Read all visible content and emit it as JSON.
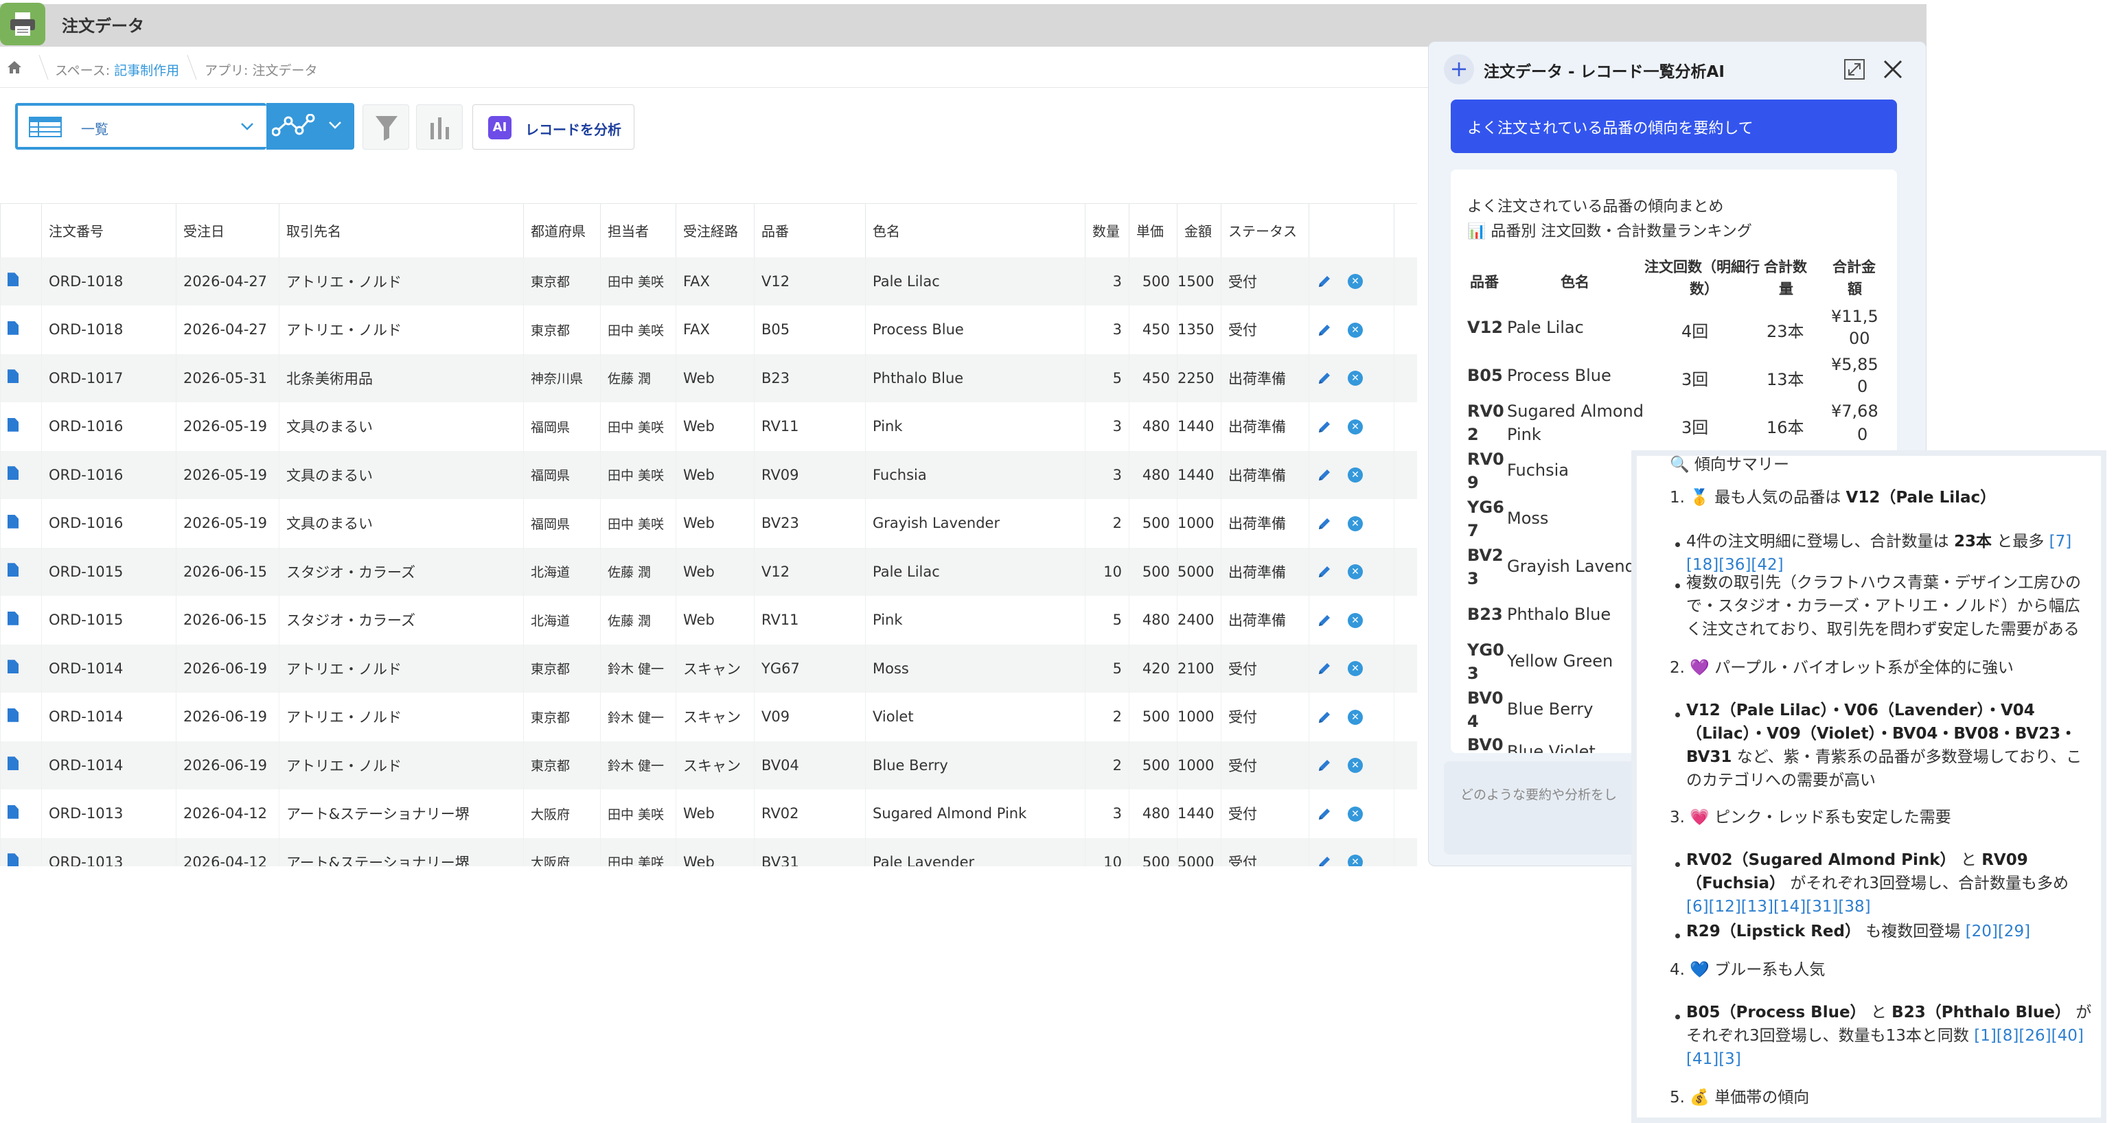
{
  "app": {
    "title": "注文データ"
  },
  "breadcrumb": {
    "space_prefix": "スペース:",
    "space_link": "記事制作用",
    "app_crumb": "アプリ: 注文データ"
  },
  "toolbar": {
    "view_label": "一覧",
    "analyze_label": "レコードを分析",
    "ai_badge": "AI"
  },
  "table": {
    "headers": [
      "注文番号",
      "受注日",
      "取引先名",
      "都道府県",
      "担当者",
      "受注経路",
      "品番",
      "色名",
      "数量",
      "単価",
      "金額",
      "ステータス"
    ],
    "rows": [
      [
        "ORD-1018",
        "2026-04-27",
        "アトリエ・ノルド",
        "東京都",
        "田中 美咲",
        "FAX",
        "V12",
        "Pale Lilac",
        "3",
        "500",
        "1500",
        "受付"
      ],
      [
        "ORD-1018",
        "2026-04-27",
        "アトリエ・ノルド",
        "東京都",
        "田中 美咲",
        "FAX",
        "B05",
        "Process Blue",
        "3",
        "450",
        "1350",
        "受付"
      ],
      [
        "ORD-1017",
        "2026-05-31",
        "北条美術用品",
        "神奈川県",
        "佐藤 潤",
        "Web",
        "B23",
        "Phthalo Blue",
        "5",
        "450",
        "2250",
        "出荷準備"
      ],
      [
        "ORD-1016",
        "2026-05-19",
        "文具のまるい",
        "福岡県",
        "田中 美咲",
        "Web",
        "RV11",
        "Pink",
        "3",
        "480",
        "1440",
        "出荷準備"
      ],
      [
        "ORD-1016",
        "2026-05-19",
        "文具のまるい",
        "福岡県",
        "田中 美咲",
        "Web",
        "RV09",
        "Fuchsia",
        "3",
        "480",
        "1440",
        "出荷準備"
      ],
      [
        "ORD-1016",
        "2026-05-19",
        "文具のまるい",
        "福岡県",
        "田中 美咲",
        "Web",
        "BV23",
        "Grayish Lavender",
        "2",
        "500",
        "1000",
        "出荷準備"
      ],
      [
        "ORD-1015",
        "2026-06-15",
        "スタジオ・カラーズ",
        "北海道",
        "佐藤 潤",
        "Web",
        "V12",
        "Pale Lilac",
        "10",
        "500",
        "5000",
        "出荷準備"
      ],
      [
        "ORD-1015",
        "2026-06-15",
        "スタジオ・カラーズ",
        "北海道",
        "佐藤 潤",
        "Web",
        "RV11",
        "Pink",
        "5",
        "480",
        "2400",
        "出荷準備"
      ],
      [
        "ORD-1014",
        "2026-06-19",
        "アトリエ・ノルド",
        "東京都",
        "鈴木 健一",
        "スキャン",
        "YG67",
        "Moss",
        "5",
        "420",
        "2100",
        "受付"
      ],
      [
        "ORD-1014",
        "2026-06-19",
        "アトリエ・ノルド",
        "東京都",
        "鈴木 健一",
        "スキャン",
        "V09",
        "Violet",
        "2",
        "500",
        "1000",
        "受付"
      ],
      [
        "ORD-1014",
        "2026-06-19",
        "アトリエ・ノルド",
        "東京都",
        "鈴木 健一",
        "スキャン",
        "BV04",
        "Blue Berry",
        "2",
        "500",
        "1000",
        "受付"
      ],
      [
        "ORD-1013",
        "2026-04-12",
        "アート&ステーショナリー堺",
        "大阪府",
        "田中 美咲",
        "Web",
        "RV02",
        "Sugared Almond Pink",
        "3",
        "480",
        "1440",
        "受付"
      ],
      [
        "ORD-1013",
        "2026-04-12",
        "アート&ステーショナリー堺",
        "大阪府",
        "田中 美咲",
        "Web",
        "BV31",
        "Pale Lavender",
        "10",
        "500",
        "5000",
        "受付"
      ]
    ]
  },
  "ai_panel": {
    "title": "注文データ - レコード一覧分析AI",
    "prompt": "よく注文されている品番の傾向を要約して",
    "result_title": "よく注文されている品番の傾向まとめ",
    "result_subtitle": "📊 品番別 注文回数・合計数量ランキング",
    "table_headers": {
      "code": "品番",
      "color": "色名",
      "count_1": "注文回数（明細行",
      "count_2": "数）",
      "qty_1": "合計数",
      "qty_2": "量",
      "amt_1": "合計金",
      "amt_2": "額"
    },
    "table_rows": [
      {
        "code": [
          "V12"
        ],
        "color": [
          "Pale Lilac"
        ],
        "count": "4回",
        "qty": "23本",
        "amount": [
          "¥11,5",
          "00"
        ]
      },
      {
        "code": [
          "B05"
        ],
        "color": [
          "Process Blue"
        ],
        "count": "3回",
        "qty": "13本",
        "amount": [
          "¥5,85",
          "0"
        ]
      },
      {
        "code": [
          "RV0",
          "2"
        ],
        "color": [
          "Sugared Almond",
          "Pink"
        ],
        "count": "3回",
        "qty": "16本",
        "amount": [
          "¥7,68",
          "0"
        ]
      },
      {
        "code": [
          "RV0",
          "9"
        ],
        "color": [
          "Fuchsia"
        ]
      },
      {
        "code": [
          "YG6",
          "7"
        ],
        "color": [
          "Moss"
        ]
      },
      {
        "code": [
          "BV2",
          "3"
        ],
        "color": [
          "Grayish Lavende"
        ]
      },
      {
        "code": [
          "B23"
        ],
        "color": [
          "Phthalo Blue"
        ]
      },
      {
        "code": [
          "YG0",
          "3"
        ],
        "color": [
          "Yellow Green"
        ]
      },
      {
        "code": [
          "BV0",
          "4"
        ],
        "color": [
          "Blue Berry"
        ]
      },
      {
        "code": [
          "BV0"
        ],
        "color": [
          "Blue Violet"
        ]
      }
    ],
    "input_placeholder": "どのような要約や分析をし"
  },
  "summary": {
    "heading": "🔍 傾向サマリー",
    "s1_title_pre": "1. 🥇 最も人気の品番は ",
    "s1_title_bold": "V12（Pale Lilac）",
    "s1_b1_pre": "4件の注文明細に登場し、合計数量は ",
    "s1_b1_bold": "23本",
    "s1_b1_post": " と最多 ",
    "s1_b1_ref1": "[7]",
    "s1_b1_refs2": "[18][36][42]",
    "s1_b2_l1": "複数の取引先（クラフトハウス青葉・デザイン工房ひの",
    "s1_b2_l2": "で・スタジオ・カラーズ・アトリエ・ノルド）から幅広",
    "s1_b2_l3": "く注文されており、取引先を問わず安定した需要がある",
    "s2_title": "2. 💜 パープル・バイオレット系が全体的に強い",
    "s2_b1_l1": "V12（Pale Lilac）・V06（Lavender）・V04",
    "s2_b1_l2": "（Lilac）・V09（Violet）・BV04・BV08・BV23・",
    "s2_b1_l3_bold": "BV31",
    "s2_b1_l3_post": " など、紫・青紫系の品番が多数登場しており、こ",
    "s2_b1_l4": "のカテゴリへの需要が高い",
    "s3_title": "3. 💗 ピンク・レッド系も安定した需要",
    "s3_b1_l1_bold1": "RV02（Sugared Almond Pink）",
    "s3_b1_l1_mid": " と ",
    "s3_b1_l1_bold2": "RV09",
    "s3_b1_l2_bold": "（Fuchsia）",
    "s3_b1_l2_post": " がそれぞれ3回登場し、合計数量も多め",
    "s3_b1_l3_refs": "[6][12][13][14][31][38]",
    "s3_b2_bold": "R29（Lipstick Red）",
    "s3_b2_post": " も複数回登場 ",
    "s3_b2_refs": "[20][29]",
    "s4_title": "4. 💙 ブルー系も人気",
    "s4_b1_l1_bold1": "B05（Process Blue）",
    "s4_b1_l1_mid": " と ",
    "s4_b1_l1_bold2": "B23（Phthalo Blue）",
    "s4_b1_l1_post": " が",
    "s4_b1_l2": "それぞれ3回登場し、数量も13本と同数 ",
    "s4_b1_l2_refs": "[1][8][26][40]",
    "s4_b1_l3_refs": "[41][3]",
    "s5_title": "5. 💰 単価帯の傾向"
  }
}
